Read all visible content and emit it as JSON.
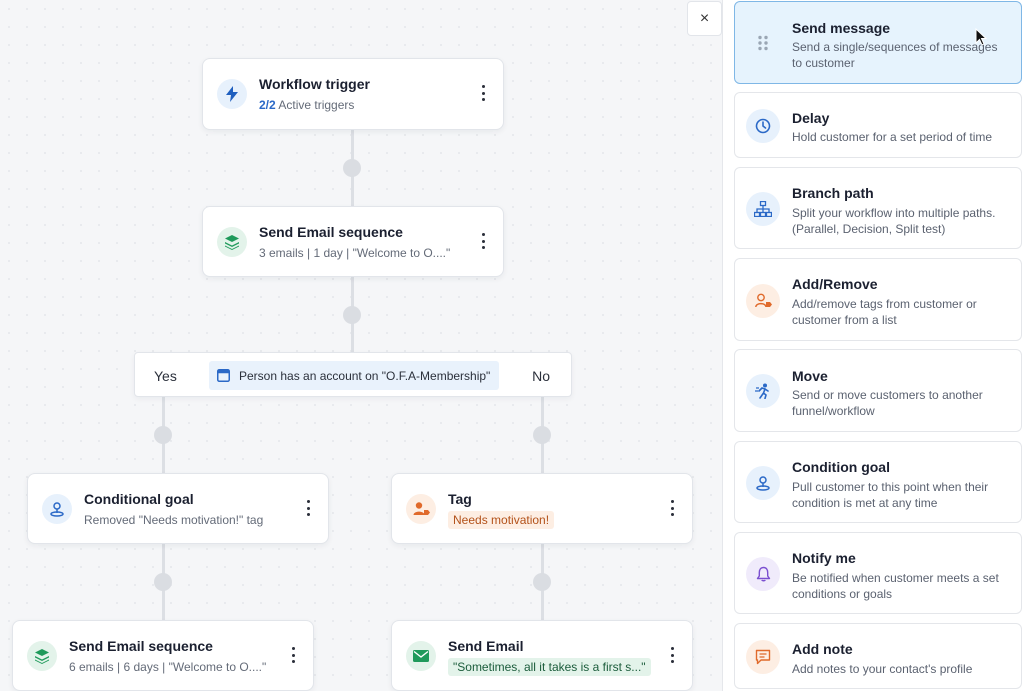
{
  "close_label": "×",
  "flow": {
    "trigger": {
      "title": "Workflow trigger",
      "count": "2/2",
      "sub": "Active triggers",
      "icon": "lightning-icon"
    },
    "email_sequence": {
      "title": "Send Email sequence",
      "sub": "3 emails | 1 day | \"Welcome to O....\"",
      "icon": "layers-icon"
    },
    "condition": {
      "yes": "Yes",
      "no": "No",
      "text": "Person has an account on \"O.F.A-Membership\"",
      "icon": "calendar-icon"
    },
    "conditional_goal": {
      "title": "Conditional goal",
      "sub": "Removed \"Needs motivation!\" tag",
      "icon": "goal-pin-icon"
    },
    "tag": {
      "title": "Tag",
      "chip": "Needs motivation!",
      "icon": "user-tag-icon"
    },
    "email_sequence_2": {
      "title": "Send Email sequence",
      "sub": "6 emails | 6 days | \"Welcome to O....\"",
      "icon": "layers-icon"
    },
    "send_email": {
      "title": "Send Email",
      "chip": "\"Sometimes, all it takes is a first s...\"",
      "icon": "envelope-icon"
    }
  },
  "panel": {
    "items": [
      {
        "title": "Send message",
        "desc": "Send a single/sequences of messages to customer",
        "icon": "drag-handle-icon"
      },
      {
        "title": "Delay",
        "desc": "Hold customer for a set period of time",
        "icon": "clock-icon"
      },
      {
        "title": "Branch path",
        "desc": "Split your workflow into multiple paths. (Parallel, Decision, Split test)",
        "icon": "hierarchy-icon"
      },
      {
        "title": "Add/Remove",
        "desc": "Add/remove tags from customer or customer from a list",
        "icon": "user-tag-icon"
      },
      {
        "title": "Move",
        "desc": "Send or move customers to another funnel/workflow",
        "icon": "running-person-icon"
      },
      {
        "title": "Condition goal",
        "desc": "Pull customer to this point when their condition is met at any time",
        "icon": "goal-pin-icon"
      },
      {
        "title": "Notify me",
        "desc": "Be notified when customer meets a set conditions or goals",
        "icon": "bell-icon"
      },
      {
        "title": "Add note",
        "desc": "Add notes to your contact's profile",
        "icon": "note-icon"
      }
    ]
  },
  "colors": {
    "accent": "#2b69c7",
    "active_card_bg": "#e6f3fd",
    "active_card_border": "#7fb7e6",
    "tag_orange": "#e06a2b",
    "email_green": "#1f9a5b",
    "notify_purple": "#7b4fd0"
  }
}
